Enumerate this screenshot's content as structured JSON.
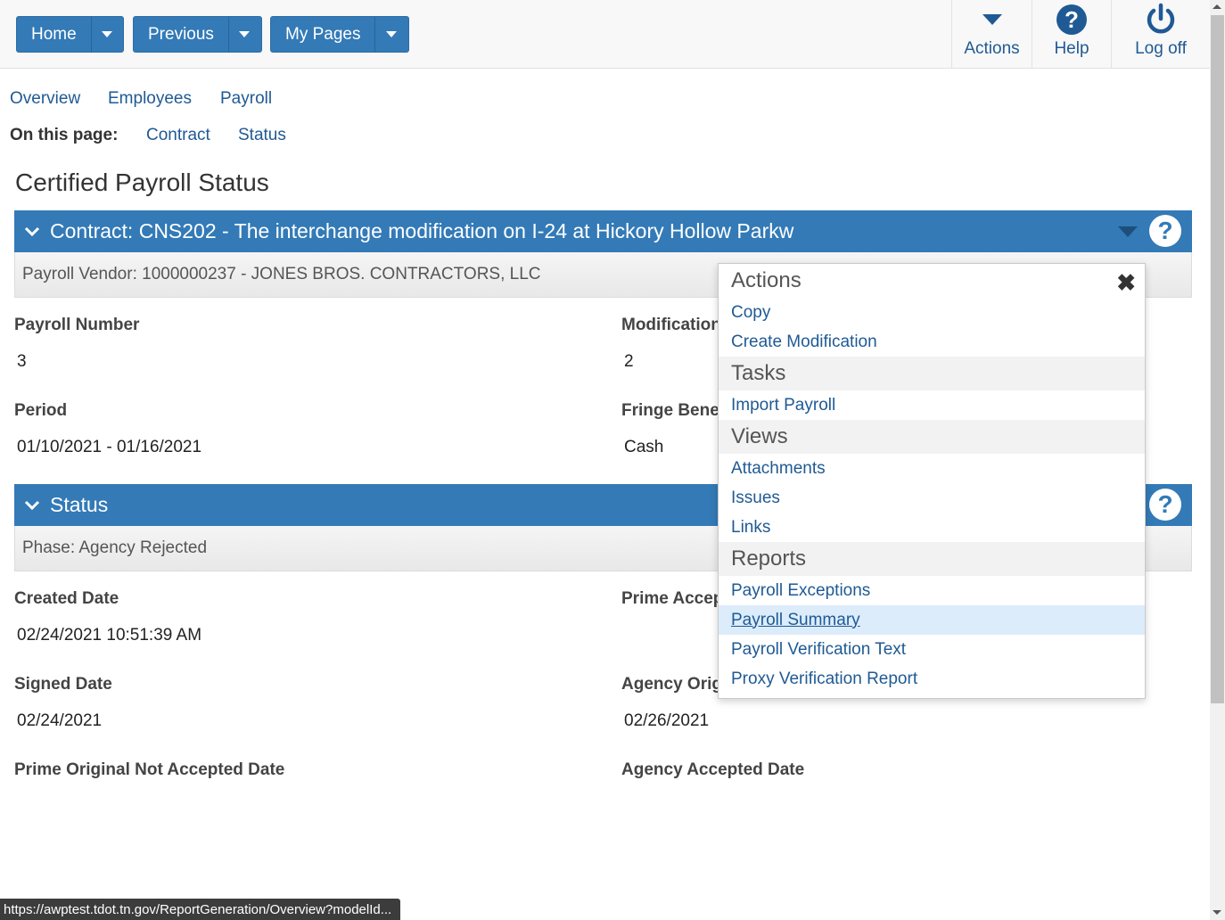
{
  "nav": {
    "home": "Home",
    "previous": "Previous",
    "my_pages": "My Pages",
    "actions": "Actions",
    "help": "Help",
    "log_off": "Log off"
  },
  "breadcrumbs": {
    "overview": "Overview",
    "employees": "Employees",
    "payroll": "Payroll"
  },
  "on_this_page": {
    "label": "On this page:",
    "contract": "Contract",
    "status": "Status"
  },
  "page_title": "Certified Payroll Status",
  "contract_panel": {
    "header": "Contract: CNS202 - The interchange modification on I-24 at Hickory Hollow Parkw",
    "vendor": "Payroll Vendor: 1000000237 - JONES BROS. CONTRACTORS, LLC",
    "fields": {
      "payroll_number_label": "Payroll Number",
      "payroll_number": "3",
      "modification_label": "Modification",
      "modification": "2",
      "period_label": "Period",
      "period": "01/10/2021 - 01/16/2021",
      "fringe_label": "Fringe Bene",
      "fringe": "Cash"
    }
  },
  "status_panel": {
    "header": "Status",
    "phase": "Phase: Agency Rejected",
    "fields": {
      "created_label": "Created Date",
      "created": "02/24/2021 10:51:39 AM",
      "prime_accepted_label": "Prime Accep",
      "signed_label": "Signed Date",
      "signed": "02/24/2021",
      "agency_orig_label": "Agency Orig",
      "agency_orig": "02/26/2021",
      "prime_not_accepted_label": "Prime Original Not Accepted Date",
      "agency_accepted_label": "Agency Accepted Date"
    }
  },
  "menu": {
    "actions_heading": "Actions",
    "copy": "Copy",
    "create_modification": "Create Modification",
    "tasks_heading": "Tasks",
    "import_payroll": "Import Payroll",
    "views_heading": "Views",
    "attachments": "Attachments",
    "issues": "Issues",
    "links": "Links",
    "reports_heading": "Reports",
    "payroll_exceptions": "Payroll Exceptions",
    "payroll_summary": "Payroll Summary",
    "payroll_verification_text": "Payroll Verification Text",
    "proxy_verification_report": "Proxy Verification Report"
  },
  "status_url": "https://awptest.tdot.tn.gov/ReportGeneration/Overview?modelId...",
  "colors": {
    "primary": "#337ab7",
    "link": "#1f5a94",
    "highlight": "#dcecfb"
  }
}
